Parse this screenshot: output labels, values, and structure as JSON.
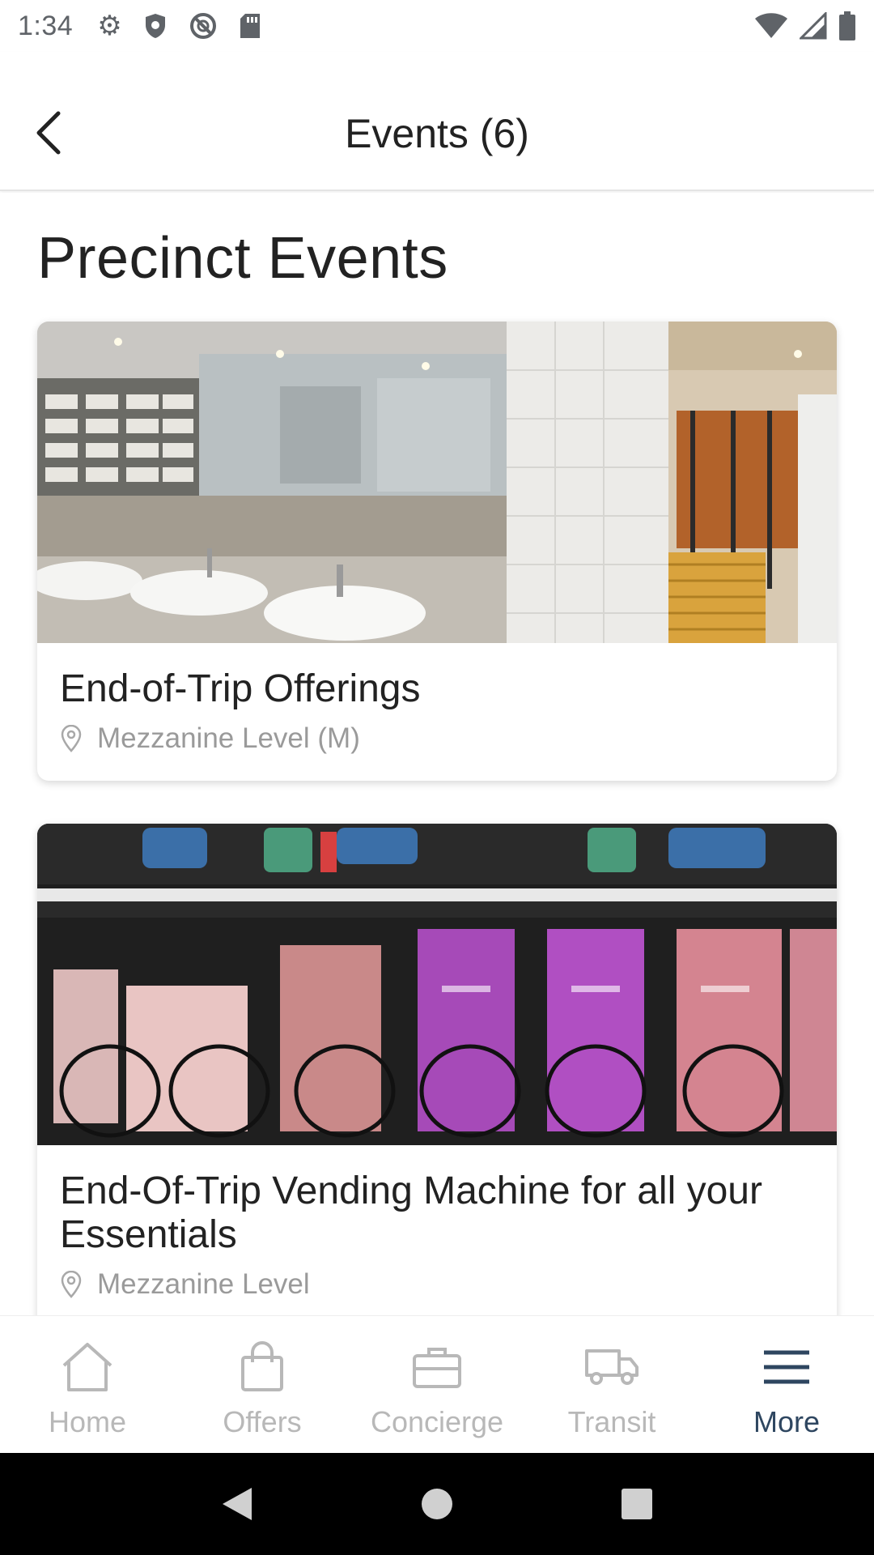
{
  "status_bar": {
    "time": "1:34"
  },
  "header": {
    "title": "Events (6)"
  },
  "section": {
    "title": "Precinct Events"
  },
  "events": [
    {
      "title": "End-of-Trip Offerings",
      "location": "Mezzanine Level (M)"
    },
    {
      "title": "End-Of-Trip Vending Machine for all your Essentials",
      "location": "Mezzanine Level"
    }
  ],
  "bottom_nav": {
    "items": [
      {
        "label": "Home",
        "icon": "home-icon",
        "active": false
      },
      {
        "label": "Offers",
        "icon": "shopping-bag-icon",
        "active": false
      },
      {
        "label": "Concierge",
        "icon": "briefcase-icon",
        "active": false
      },
      {
        "label": "Transit",
        "icon": "truck-icon",
        "active": false
      },
      {
        "label": "More",
        "icon": "menu-icon",
        "active": true
      }
    ],
    "active_color": "#2e4660",
    "inactive_color": "#b8b8b8"
  }
}
